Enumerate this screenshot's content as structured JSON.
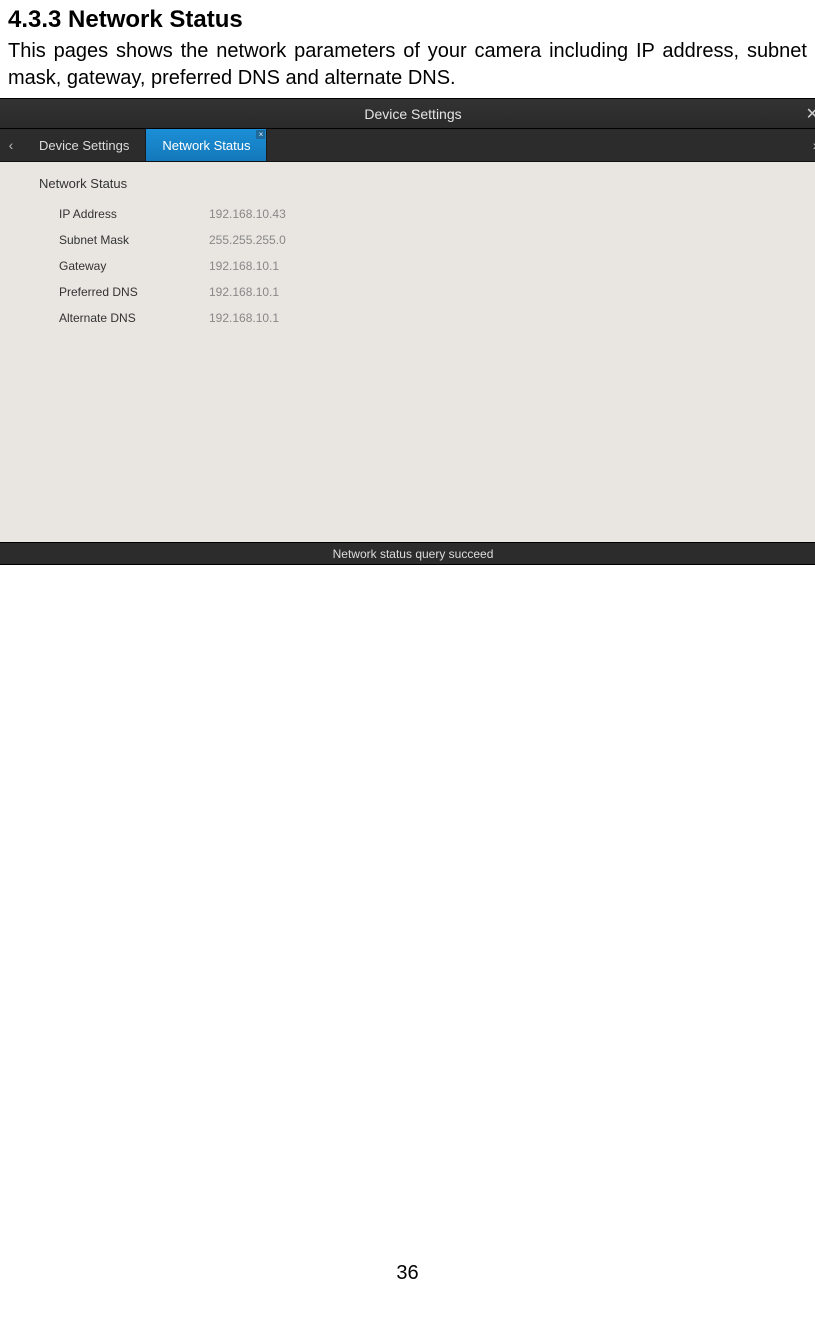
{
  "doc": {
    "heading": "4.3.3 Network Status",
    "description": "This pages shows the network parameters of your camera including IP address, subnet mask, gateway, preferred DNS and alternate DNS.",
    "page_number": "36"
  },
  "titlebar": {
    "title": "Device Settings",
    "close": "✕"
  },
  "tabs": {
    "left_arrow": "‹",
    "right_arrow": "›",
    "items": [
      {
        "label": "Device Settings",
        "active": false
      },
      {
        "label": "Network Status",
        "active": true
      }
    ],
    "tab_close": "×"
  },
  "panel": {
    "title": "Network Status",
    "fields": [
      {
        "label": "IP Address",
        "value": "192.168.10.43"
      },
      {
        "label": "Subnet Mask",
        "value": "255.255.255.0"
      },
      {
        "label": "Gateway",
        "value": "192.168.10.1"
      },
      {
        "label": "Preferred DNS",
        "value": "192.168.10.1"
      },
      {
        "label": "Alternate DNS",
        "value": "192.168.10.1"
      }
    ]
  },
  "statusbar": {
    "text": "Network status query succeed"
  }
}
